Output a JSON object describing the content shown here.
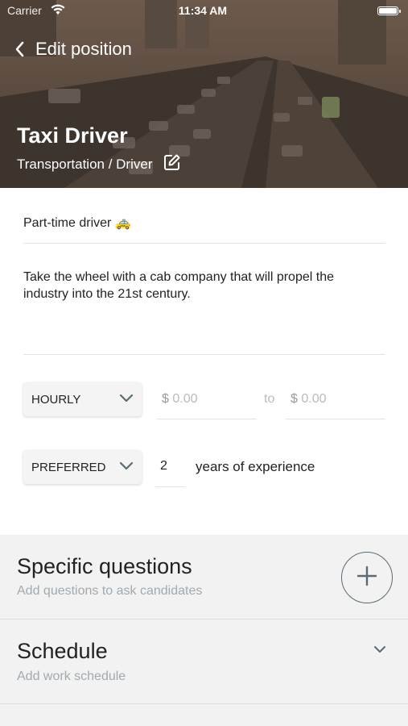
{
  "status_bar": {
    "carrier": "Carrier",
    "time": "11:34 AM"
  },
  "nav": {
    "title": "Edit position"
  },
  "position": {
    "title": "Taxi Driver",
    "category": "Transportation / Driver",
    "name": "Part-time driver 🚕",
    "description": "Take the wheel with a cab company that will propel the industry into the 21st century."
  },
  "pay": {
    "rate_type": "HOURLY",
    "currency_symbol": "$",
    "min_placeholder": "0.00",
    "to_label": "to",
    "max_placeholder": "0.00"
  },
  "experience": {
    "requirement": "PREFERRED",
    "years": "2",
    "label": "years of experience"
  },
  "sections": {
    "questions": {
      "title": "Specific questions",
      "subtitle": "Add questions to ask candidates"
    },
    "schedule": {
      "title": "Schedule",
      "subtitle": "Add work schedule"
    }
  },
  "icons": {
    "back": "chevron-left-icon",
    "edit": "edit-icon",
    "dropdown": "chevron-down-icon",
    "add": "plus-icon",
    "expand": "chevron-down-icon"
  },
  "colors": {
    "accent_outline": "#5a6b75",
    "section_bg": "#f2f2f2",
    "subtitle": "#a0aab0"
  }
}
